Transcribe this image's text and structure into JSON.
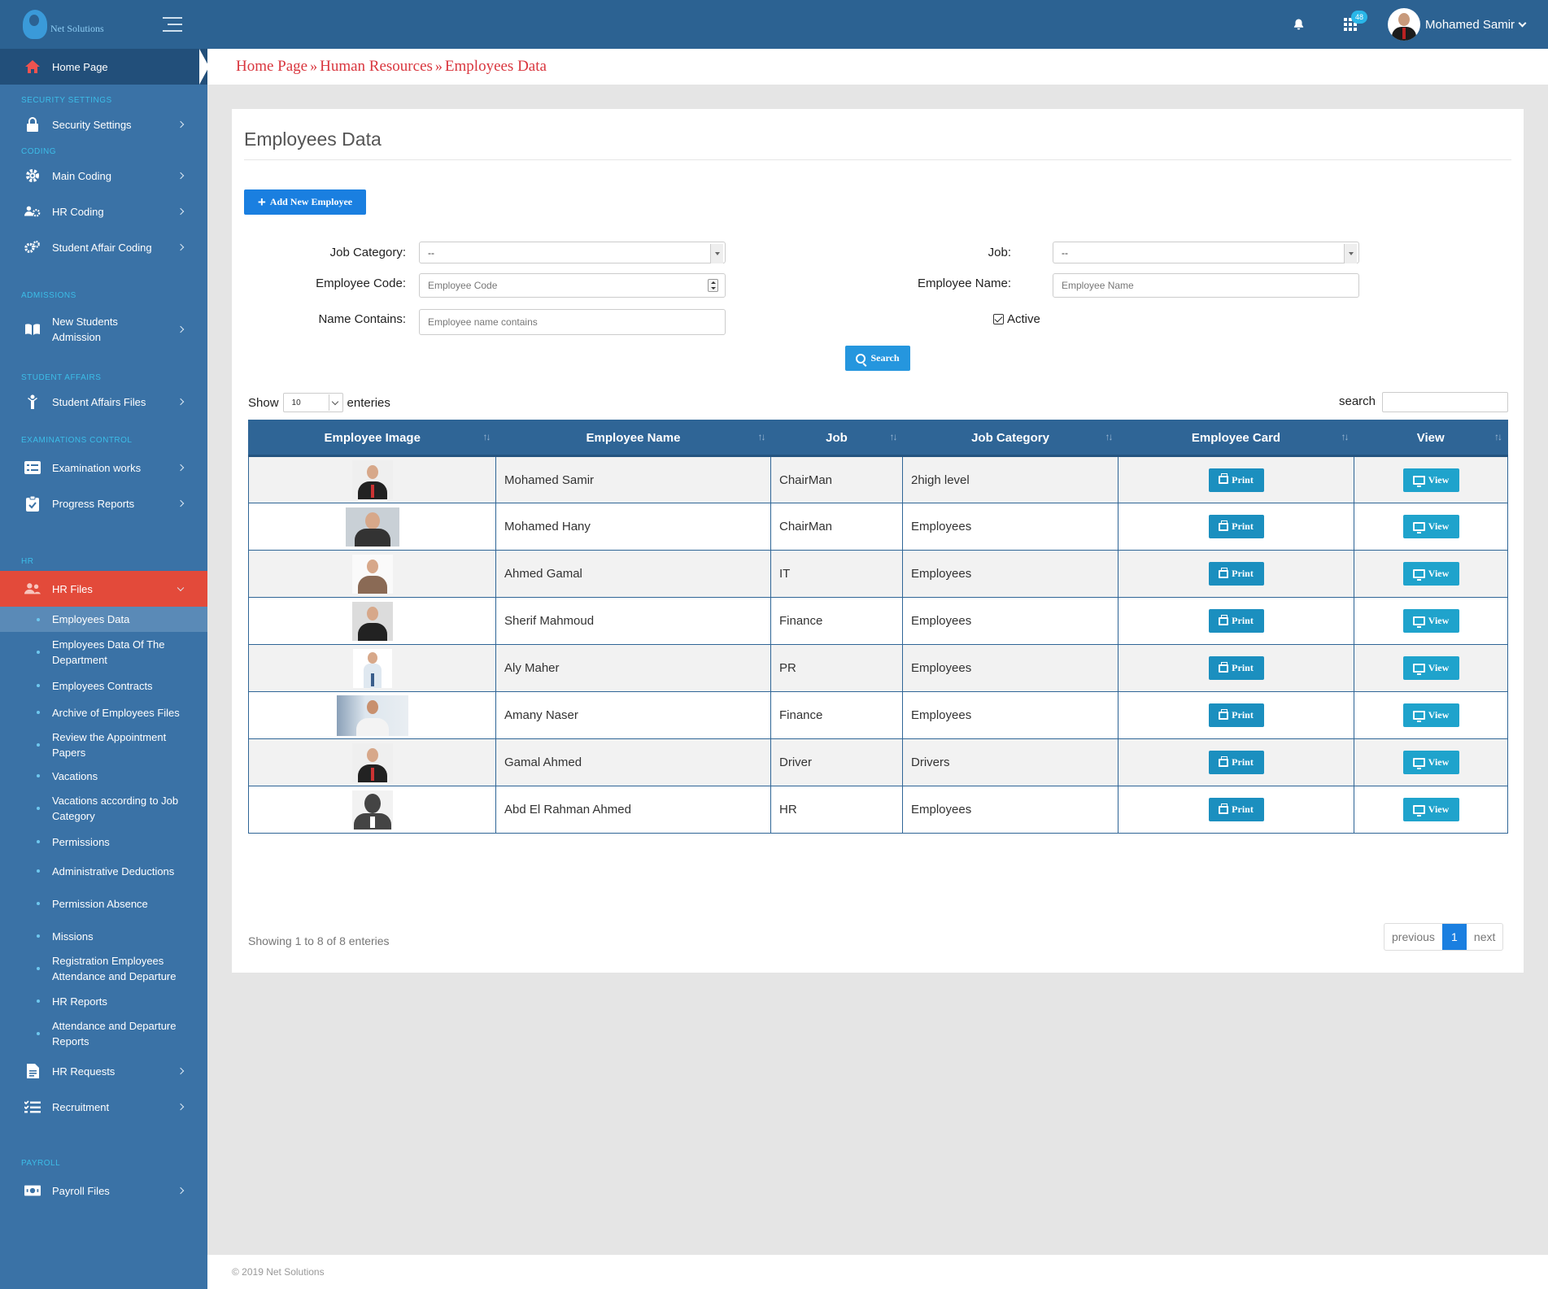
{
  "app": {
    "logo_text": "Net Solutions",
    "notification_badge": "48",
    "user_name": "Mohamed Samir"
  },
  "breadcrumb": {
    "items": [
      "Home Page",
      "Human Resources",
      "Employees Data"
    ],
    "separator": "»"
  },
  "sidebar": {
    "home": "Home Page",
    "sections": {
      "security": "SECURITY SETTINGS",
      "coding": "CODING",
      "admissions": "ADMISSIONS",
      "student_affairs": "STUDENT AFFAIRS",
      "exams": "EXAMINATIONS CONTROL",
      "hr": "HR",
      "payroll": "PAYROLL"
    },
    "items": {
      "security_settings": "Security Settings",
      "main_coding": "Main Coding",
      "hr_coding": "HR Coding",
      "student_affair_coding": "Student Affair Coding",
      "new_students_1": "New Students",
      "new_students_2": "Admission",
      "student_affairs_files": "Student Affairs Files",
      "examination_works": "Examination works",
      "progress_reports": "Progress Reports",
      "hr_files": "HR Files",
      "hr_requests": "HR Requests",
      "recruitment": "Recruitment",
      "payroll_files": "Payroll Files"
    },
    "hr_sub": [
      "Employees Data",
      "Employees Data Of The Department",
      "Employees Contracts",
      "Archive of Employees Files",
      "Review the Appointment Papers",
      "Vacations",
      "Vacations according to Job Category",
      "Permissions",
      "Administrative Deductions",
      "Permission Absence",
      "Missions",
      "Registration Employees Attendance and Departure",
      "HR Reports",
      "Attendance and Departure Reports"
    ]
  },
  "page": {
    "title": "Employees Data",
    "add_button": "Add New Employee",
    "filters": {
      "job_category_label": "Job Category:",
      "job_category_value": "--",
      "job_label": "Job:",
      "job_value": "--",
      "employee_code_label": "Employee Code:",
      "employee_code_placeholder": "Employee Code",
      "employee_name_label": "Employee Name:",
      "employee_name_placeholder": "Employee Name",
      "name_contains_label": "Name Contains:",
      "name_contains_placeholder": "Employee name contains",
      "active_label": "Active",
      "active_checked": true
    },
    "search_button": "Search",
    "show_label": "Show",
    "page_length": "10",
    "entries_label": "enteries",
    "search_label": "search"
  },
  "table": {
    "columns": [
      "Employee Image",
      "Employee Name",
      "Job",
      "Job Category",
      "Employee Card",
      "View"
    ],
    "print_label": "Print",
    "view_label": "View",
    "rows": [
      {
        "name": "Mohamed Samir",
        "job": "ChairMan",
        "category": "2high level"
      },
      {
        "name": "Mohamed Hany",
        "job": "ChairMan",
        "category": "Employees"
      },
      {
        "name": "Ahmed Gamal",
        "job": "IT",
        "category": "Employees"
      },
      {
        "name": "Sherif Mahmoud",
        "job": "Finance",
        "category": "Employees"
      },
      {
        "name": "Aly Maher",
        "job": "PR",
        "category": "Employees"
      },
      {
        "name": "Amany Naser",
        "job": "Finance",
        "category": "Employees"
      },
      {
        "name": "Gamal Ahmed",
        "job": "Driver",
        "category": "Drivers"
      },
      {
        "name": "Abd El Rahman Ahmed",
        "job": "HR",
        "category": "Employees"
      }
    ]
  },
  "pagination": {
    "info": "Showing 1 to 8 of 8 enteries",
    "previous": "previous",
    "current": "1",
    "next": "next"
  },
  "footer": {
    "copyright": "© 2019 Net Solutions"
  },
  "colors": {
    "topbar": "#2c6292",
    "sidebar": "#3a72a6",
    "accent_red": "#e34a3a",
    "breadcrumb": "#d9363e",
    "primary_button": "#1a7fe0"
  }
}
